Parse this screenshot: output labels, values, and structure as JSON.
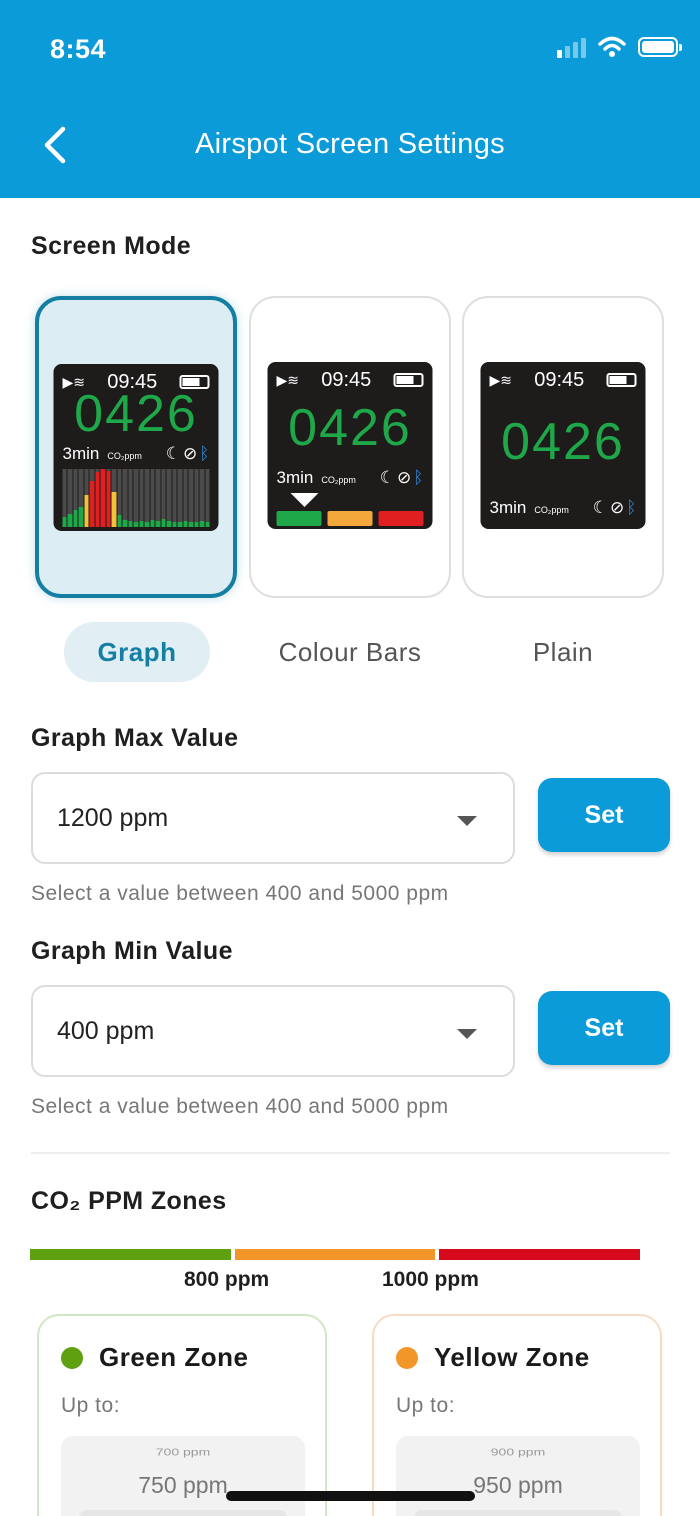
{
  "status_bar": {
    "time": "8:54"
  },
  "header": {
    "title": "Airspot Screen Settings"
  },
  "screen_mode": {
    "title": "Screen Mode",
    "options": [
      {
        "label": "Graph",
        "selected": true
      },
      {
        "label": "Colour Bars",
        "selected": false
      },
      {
        "label": "Plain",
        "selected": false
      }
    ],
    "preview": {
      "time": "09:45",
      "value": "0426",
      "interval": "3min",
      "unit": "CO₂ppm"
    }
  },
  "graph_max": {
    "title": "Graph Max Value",
    "value": "1200 ppm",
    "button": "Set",
    "helper": "Select a value between 400 and 5000 ppm"
  },
  "graph_min": {
    "title": "Graph Min Value",
    "value": "400 ppm",
    "button": "Set",
    "helper": "Select a value between 400 and 5000 ppm"
  },
  "zones": {
    "title": "CO₂ PPM Zones",
    "thresholds": [
      "800 ppm",
      "1000 ppm"
    ],
    "colors": {
      "green": "#5fa010",
      "yellow": "#f3962a",
      "red": "#d6091d"
    },
    "cards": [
      {
        "name": "Green Zone",
        "sub": "Up to:",
        "prev": "700 ppm",
        "current": "750 ppm"
      },
      {
        "name": "Yellow Zone",
        "sub": "Up to:",
        "prev": "900 ppm",
        "current": "950 ppm"
      }
    ]
  },
  "accent": "#0a9bd8"
}
